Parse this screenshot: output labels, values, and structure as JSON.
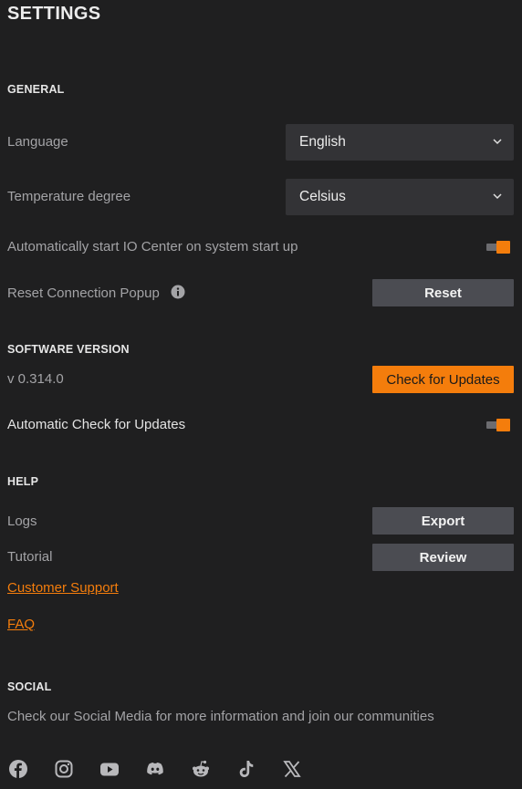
{
  "page": {
    "title": "SETTINGS"
  },
  "general": {
    "heading": "GENERAL",
    "language_label": "Language",
    "language_value": "English",
    "temperature_label": "Temperature degree",
    "temperature_value": "Celsius",
    "autostart_label": "Automatically start IO Center on system start up",
    "autostart_enabled": true,
    "reset_popup_label": "Reset Connection Popup",
    "reset_button": "Reset"
  },
  "software": {
    "heading": "SOFTWARE VERSION",
    "version": "v 0.314.0",
    "check_button": "Check for Updates",
    "auto_check_label": "Automatic Check for Updates",
    "auto_check_enabled": true
  },
  "help": {
    "heading": "HELP",
    "logs_label": "Logs",
    "export_button": "Export",
    "tutorial_label": "Tutorial",
    "review_button": "Review",
    "support_link": "Customer Support",
    "faq_link": "FAQ"
  },
  "social": {
    "heading": "SOCIAL",
    "description": "Check our Social Media for more information and join our communities",
    "icons": [
      "facebook-icon",
      "instagram-icon",
      "youtube-icon",
      "discord-icon",
      "reddit-icon",
      "tiktok-icon",
      "x-icon"
    ]
  },
  "colors": {
    "accent": "#f47d0c",
    "background": "#1f1f20",
    "control": "#333336",
    "button": "#4b4c52"
  }
}
